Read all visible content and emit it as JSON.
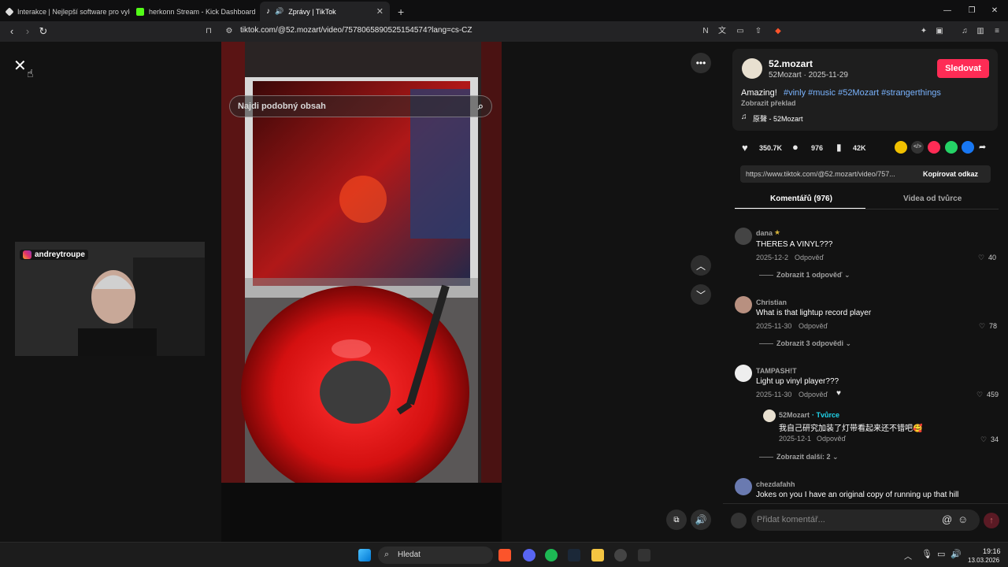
{
  "tabs": [
    {
      "title": "Interakce | Nejlepší software pro vyle",
      "color": "#ffffff"
    },
    {
      "title": "herkonn Stream - Kick Dashboard",
      "color": "#53fc18"
    },
    {
      "title": "Zprávy | TikTok",
      "color": "#ffffff"
    }
  ],
  "address": {
    "url": "tiktok.com/@52.mozart/video/7578065890525154574?lang=cs-CZ"
  },
  "video": {
    "search_placeholder": "Najdi podobný obsah",
    "webcam_handle": "andreytroupe"
  },
  "post": {
    "author_display": "52.mozart",
    "author_line": "52Mozart · 2025-11-29",
    "follow_label": "Sledovat",
    "caption_prefix": "Amazing!",
    "hashtags": "#vinly #music #52Mozart #strangerthings",
    "translate_label": "Zobrazit překlad",
    "sound": "原聲 - 52Mozart",
    "likes": "350.7K",
    "comments": "976",
    "saves": "42K",
    "link": "https://www.tiktok.com/@52.mozart/video/757...",
    "copy_link_label": "Kopírovat odkaz"
  },
  "panel_tabs": {
    "comments": "Komentářů (976)",
    "creator_videos": "Videa od tvůrce"
  },
  "comments": [
    {
      "user": "dana",
      "text": "THERES A VINYL???",
      "date": "2025-12-2",
      "reply": "Odpověď",
      "likes": "40",
      "more": "Zobrazit 1 odpověď"
    },
    {
      "user": "Christian",
      "text": "What is that lightup record player",
      "date": "2025-11-30",
      "reply": "Odpověď",
      "likes": "78",
      "more": "Zobrazit 3 odpovědi"
    },
    {
      "user": "TAMPASH!T",
      "text": "Light up vinyl player???",
      "date": "2025-11-30",
      "reply": "Odpověď",
      "likes": "459",
      "more": "Zobrazit další: 2"
    },
    {
      "user": "chezdafahh",
      "text": "Jokes on you I have an original copy of running up that hill",
      "date": "",
      "reply": "",
      "likes": "",
      "more": ""
    }
  ],
  "creator_reply": {
    "user": "52Mozart",
    "badge": "· Tvůrce",
    "text": "我自己研究加装了灯带看起来还不错吧🥰",
    "date": "2025-12-1",
    "reply": "Odpověď",
    "likes": "34"
  },
  "comment_input": {
    "placeholder": "Přidat komentář..."
  },
  "taskbar": {
    "search_label": "Hledat",
    "time": "19:16",
    "date": "13.03.2026"
  },
  "colors": {
    "accent": "#fe2c55",
    "hashtag": "#7ab4ff",
    "creator": "#20d5ec"
  }
}
